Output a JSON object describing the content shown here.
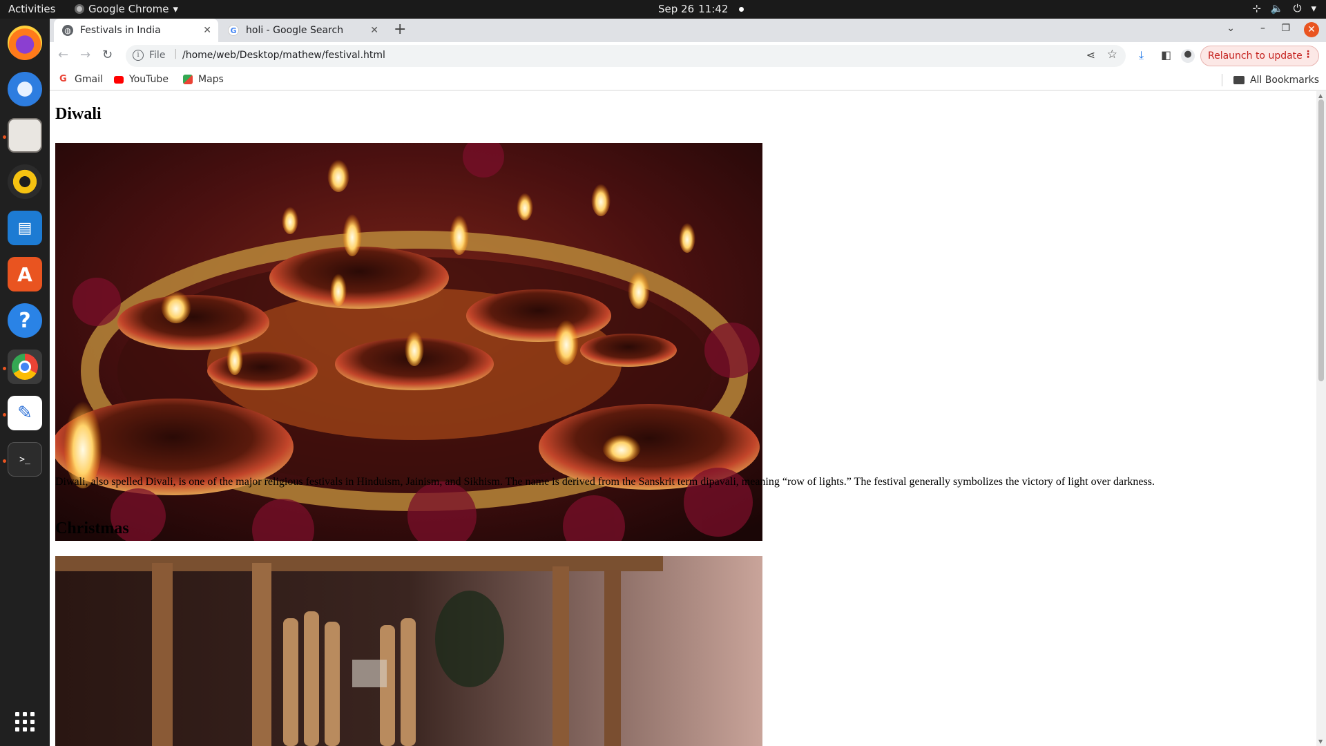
{
  "system": {
    "activities": "Activities",
    "app_name": "Google Chrome",
    "date": "Sep 26",
    "time": "11:42"
  },
  "dock": {
    "items": [
      "firefox",
      "thunderbird",
      "files",
      "rhythmbox",
      "libreoffice-writer",
      "app-center",
      "help",
      "google-chrome",
      "text-editor",
      "terminal",
      "show-apps"
    ]
  },
  "browser": {
    "tabs": [
      {
        "title": "Festivals in India",
        "active": true
      },
      {
        "title": "holi - Google Search",
        "active": false
      }
    ],
    "new_tab": "+",
    "address": {
      "scheme": "File",
      "url": "/home/web/Desktop/mathew/festival.html"
    },
    "relaunch_label": "Relaunch to update",
    "bookmarks": [
      {
        "label": "Gmail",
        "icon": "gmail-icon"
      },
      {
        "label": "YouTube",
        "icon": "youtube-icon"
      },
      {
        "label": "Maps",
        "icon": "maps-icon"
      }
    ],
    "all_bookmarks": "All Bookmarks"
  },
  "page": {
    "sections": [
      {
        "heading": "Diwali",
        "image": "diya-lamps-photo",
        "text": "Diwali, also spelled Divali, is one of the major religious festivals in Hinduism, Jainism, and Sikhism. The name is derived from the Sanskrit term dipavali, meaning “row of lights.” The festival generally symbolizes the victory of light over darkness."
      },
      {
        "heading": "Christmas",
        "image": "nativity-scene-photo"
      }
    ]
  },
  "colors": {
    "accent": "#e95420",
    "relaunch_text": "#c5221f",
    "relaunch_bg": "#fce8e6"
  }
}
